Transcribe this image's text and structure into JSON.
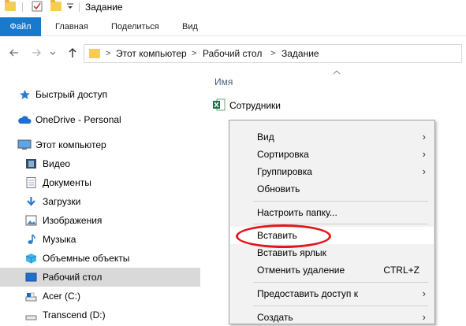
{
  "titlebar": {
    "title": "Задание",
    "icons": [
      "folder-icon",
      "properties-icon",
      "new-folder-icon",
      "chevron-down-icon"
    ]
  },
  "ribbon": {
    "tabs": [
      "Файл",
      "Главная",
      "Поделиться",
      "Вид"
    ],
    "accent": "#1979ca"
  },
  "address": {
    "breadcrumbs": [
      "Этот компьютер",
      "Рабочий стол",
      "Задание"
    ],
    "separator": ">"
  },
  "sidebar": {
    "items": [
      {
        "label": "Быстрый доступ",
        "icon": "star-icon"
      },
      {
        "label": "OneDrive - Personal",
        "icon": "cloud-icon"
      },
      {
        "label": "Этот компьютер",
        "icon": "computer-icon"
      },
      {
        "label": "Видео",
        "icon": "video-icon"
      },
      {
        "label": "Документы",
        "icon": "document-icon"
      },
      {
        "label": "Загрузки",
        "icon": "download-icon"
      },
      {
        "label": "Изображения",
        "icon": "image-icon"
      },
      {
        "label": "Музыка",
        "icon": "music-icon"
      },
      {
        "label": "Объемные объекты",
        "icon": "cube-icon"
      },
      {
        "label": "Рабочий стол",
        "icon": "desktop-icon"
      },
      {
        "label": "Acer (C:)",
        "icon": "drive-icon"
      },
      {
        "label": "Transcend (D:)",
        "icon": "drive-icon"
      }
    ],
    "selected": "Рабочий стол"
  },
  "content": {
    "column_header": "Имя",
    "files": [
      {
        "name": "Сотрудники",
        "icon": "excel-icon"
      }
    ]
  },
  "context_menu": {
    "items": [
      {
        "label": "Вид",
        "submenu": true
      },
      {
        "label": "Сортировка",
        "submenu": true
      },
      {
        "label": "Группировка",
        "submenu": true
      },
      {
        "label": "Обновить"
      },
      {
        "label": "Настроить папку..."
      },
      {
        "label": "Вставить",
        "highlighted": true
      },
      {
        "label": "Вставить ярлык"
      },
      {
        "label": "Отменить удаление",
        "shortcut": "CTRL+Z"
      },
      {
        "label": "Предоставить доступ к",
        "submenu": true
      },
      {
        "label": "Создать",
        "submenu": true
      }
    ],
    "annotation_color": "#e3161b"
  }
}
